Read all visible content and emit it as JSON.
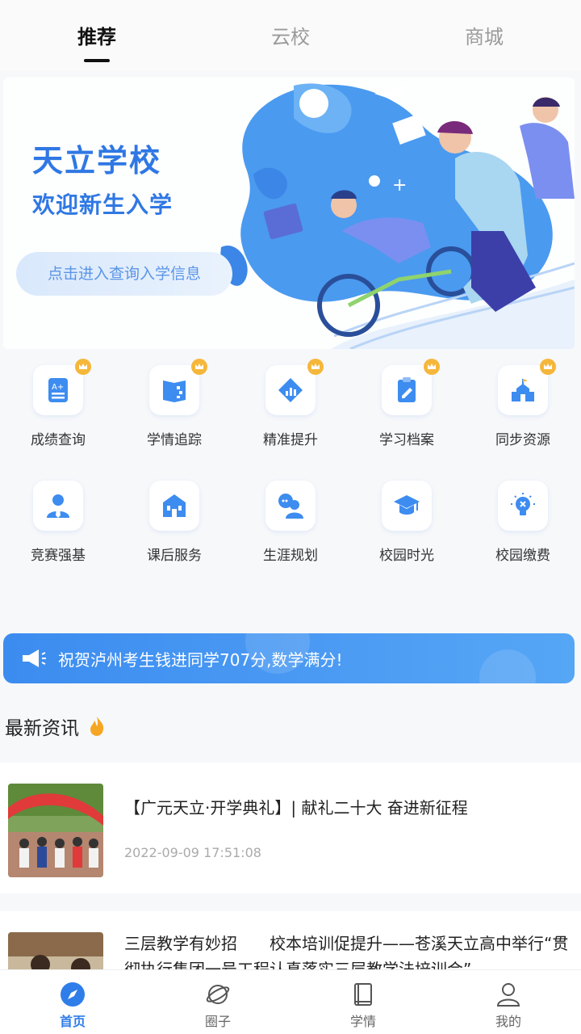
{
  "top_tabs": [
    {
      "label": "推荐",
      "active": true
    },
    {
      "label": "云校",
      "active": false
    },
    {
      "label": "商城",
      "active": false
    }
  ],
  "banner": {
    "title": "天立学校",
    "subtitle": "欢迎新生入学",
    "cta": "点击进入查询入学信息"
  },
  "grid": {
    "row1": [
      {
        "label": "成绩查询",
        "icon": "report-icon",
        "crown": true
      },
      {
        "label": "学情追踪",
        "icon": "book-track-icon",
        "crown": true
      },
      {
        "label": "精准提升",
        "icon": "diamond-chart-icon",
        "crown": true
      },
      {
        "label": "学习档案",
        "icon": "clipboard-edit-icon",
        "crown": true
      },
      {
        "label": "同步资源",
        "icon": "school-building-icon",
        "crown": true
      }
    ],
    "row2": [
      {
        "label": "竞赛强基",
        "icon": "person-tie-icon",
        "crown": false
      },
      {
        "label": "课后服务",
        "icon": "building-icon",
        "crown": false
      },
      {
        "label": "生涯规划",
        "icon": "chat-person-icon",
        "crown": false
      },
      {
        "label": "校园时光",
        "icon": "graduation-cap-icon",
        "crown": false
      },
      {
        "label": "校园缴费",
        "icon": "lightbulb-icon",
        "crown": false
      }
    ]
  },
  "notice": {
    "text": "祝贺泸州考生钱进同学707分,数学满分!",
    "icon": "megaphone-icon"
  },
  "news": {
    "header": "最新资讯",
    "items": [
      {
        "title": "【广元天立·开学典礼】| 献礼二十大 奋进新征程",
        "date": "2022-09-09 17:51:08"
      },
      {
        "title": "三层教学有妙招　　校本培训促提升——苍溪天立高中举行“贯彻执行集团一号工程认真落实三层教学法培训会”",
        "date": ""
      }
    ]
  },
  "bottom_nav": [
    {
      "label": "首页",
      "icon": "compass-icon",
      "active": true
    },
    {
      "label": "圈子",
      "icon": "planet-icon",
      "active": false
    },
    {
      "label": "学情",
      "icon": "book-icon",
      "active": false
    },
    {
      "label": "我的",
      "icon": "user-icon",
      "active": false
    }
  ],
  "colors": {
    "accent": "#2f7de8",
    "notice_bg": "#3c8cf0",
    "banner_title": "#2f78e4"
  }
}
